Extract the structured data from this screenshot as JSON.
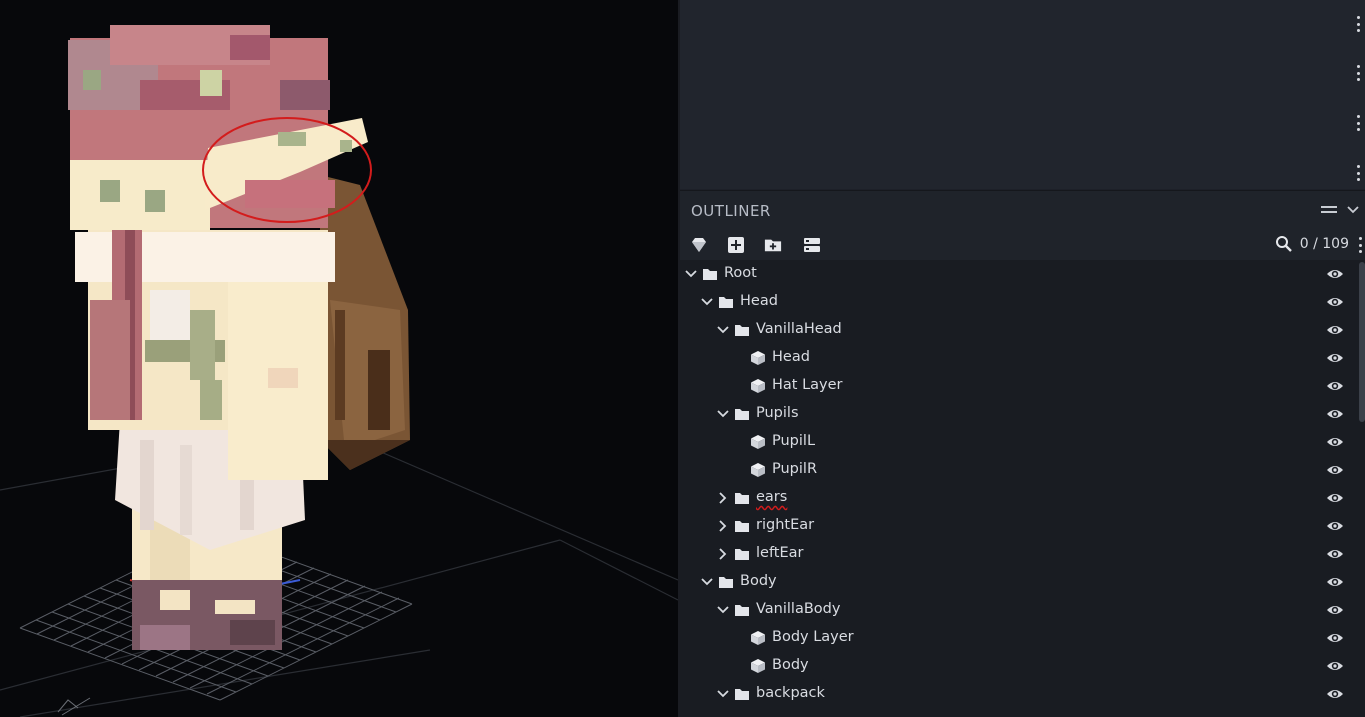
{
  "outliner": {
    "title": "OUTLINER",
    "count": "0 / 109",
    "tree": [
      {
        "label": "Root",
        "type": "folder",
        "depth": 0,
        "expanded": true
      },
      {
        "label": "Head",
        "type": "folder",
        "depth": 1,
        "expanded": true
      },
      {
        "label": "VanillaHead",
        "type": "folder",
        "depth": 2,
        "expanded": true
      },
      {
        "label": "Head",
        "type": "cube",
        "depth": 3
      },
      {
        "label": "Hat Layer",
        "type": "cube",
        "depth": 3
      },
      {
        "label": "Pupils",
        "type": "folder",
        "depth": 2,
        "expanded": true
      },
      {
        "label": "PupilL",
        "type": "cube",
        "depth": 3
      },
      {
        "label": "PupilR",
        "type": "cube",
        "depth": 3
      },
      {
        "label": "ears",
        "type": "folder",
        "depth": 2,
        "expanded": false,
        "underlined": true
      },
      {
        "label": "rightEar",
        "type": "folder",
        "depth": 2,
        "expanded": false
      },
      {
        "label": "leftEar",
        "type": "folder",
        "depth": 2,
        "expanded": false
      },
      {
        "label": "Body",
        "type": "folder",
        "depth": 1,
        "expanded": true
      },
      {
        "label": "VanillaBody",
        "type": "folder",
        "depth": 2,
        "expanded": true
      },
      {
        "label": "Body Layer",
        "type": "cube",
        "depth": 3
      },
      {
        "label": "Body",
        "type": "cube",
        "depth": 3
      },
      {
        "label": "backpack",
        "type": "folder",
        "depth": 2,
        "expanded": true
      }
    ]
  },
  "icons": {
    "toolbar": [
      "gem-icon",
      "add-cube-icon",
      "add-folder-icon",
      "collapse-all-icon"
    ],
    "search": "search-icon",
    "row_visibility": "eye-icon"
  },
  "colors": {
    "panel_bg": "#1d2028",
    "tree_bg": "#191c22",
    "annotation": "#d31c1c"
  }
}
